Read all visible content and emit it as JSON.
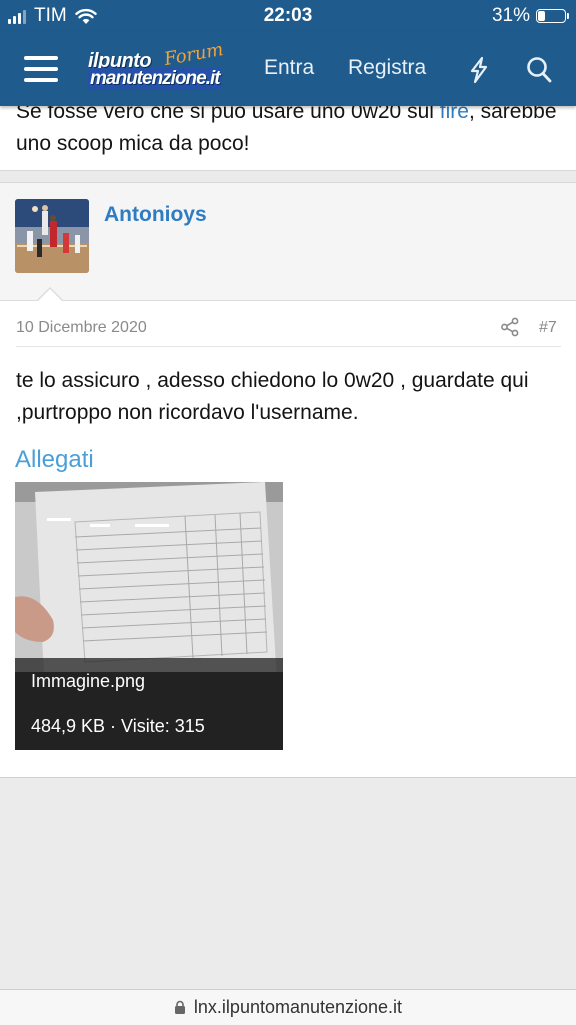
{
  "status_bar": {
    "carrier": "TIM",
    "time": "22:03",
    "battery_percent": "31%",
    "battery_level": 0.31
  },
  "nav": {
    "logo_line1": "ilpunto",
    "logo_line2": "manutenzione.it",
    "logo_forum": "Forum",
    "login_label": "Entra",
    "register_label": "Registra",
    "icons": [
      "menu-icon",
      "lightning-icon",
      "search-icon"
    ]
  },
  "previous_post": {
    "text_before": "Se fosse vero che si può usare uno 0w20 sul ",
    "link_text": "fire",
    "text_after": ", sarebbe uno scoop mica da poco!"
  },
  "post": {
    "username": "Antonioys",
    "date": "10 Dicembre 2020",
    "number": "#7",
    "body": "te lo assicuro , adesso chiedono lo 0w20 , guardate qui ,purtroppo non ricordavo l'username.",
    "attachments_title": "Allegati",
    "attachment": {
      "filename": "Immagine.png",
      "meta": "484,9 KB · Visite: 315"
    }
  },
  "url_bar": {
    "url": "lnx.ilpuntomanutenzione.it"
  },
  "colors": {
    "header_blue": "#1f5b8c",
    "link_blue": "#2f7cc1",
    "attach_title_blue": "#4a9fd8"
  }
}
